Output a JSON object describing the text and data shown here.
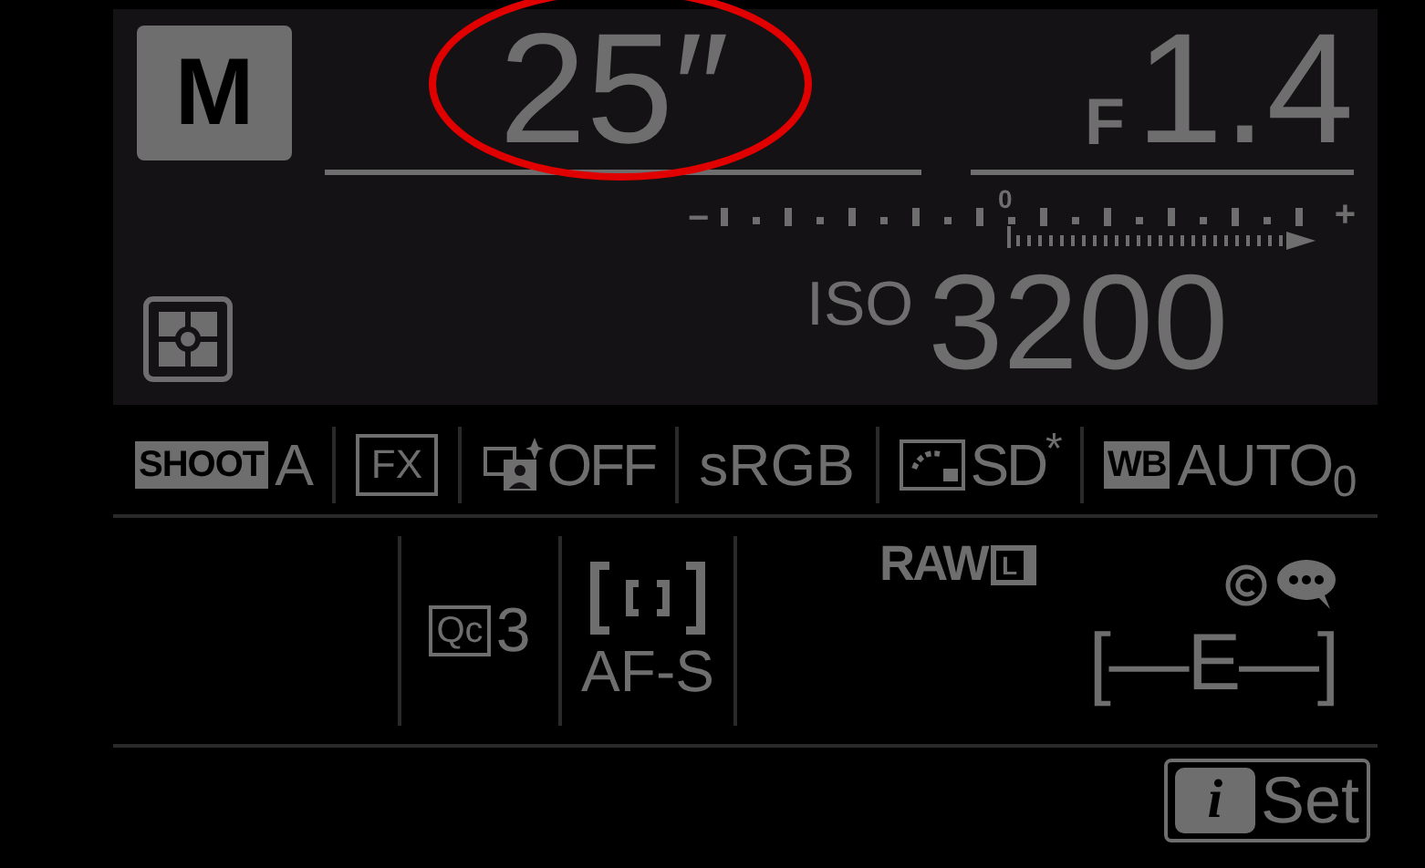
{
  "exposure_mode": "M",
  "shutter": {
    "value": "25″",
    "highlighted": true
  },
  "aperture": {
    "prefix": "F",
    "value": "1.4"
  },
  "meter": {
    "minus": "−",
    "zero": "0",
    "plus": "+"
  },
  "iso": {
    "label": "ISO",
    "value": "3200"
  },
  "settings_row": [
    {
      "kind": "badge",
      "badge": "SHOOT",
      "value": "A"
    },
    {
      "kind": "boxed",
      "value": "FX"
    },
    {
      "kind": "dlighting",
      "value": "OFF"
    },
    {
      "kind": "plain",
      "value": "sRGB"
    },
    {
      "kind": "picture-control",
      "value": "SD$^{*}$"
    },
    {
      "kind": "badge",
      "badge": "WB",
      "value": "AUTO$_{0}$"
    }
  ],
  "quality_row": {
    "release_badge": "Qc",
    "release_value": "3",
    "focus_mode": "AF-S",
    "image_quality": "RAW",
    "image_size": "L",
    "exposure_delay": "[—E—]"
  },
  "set_button": {
    "icon": "i",
    "label": "Set"
  }
}
